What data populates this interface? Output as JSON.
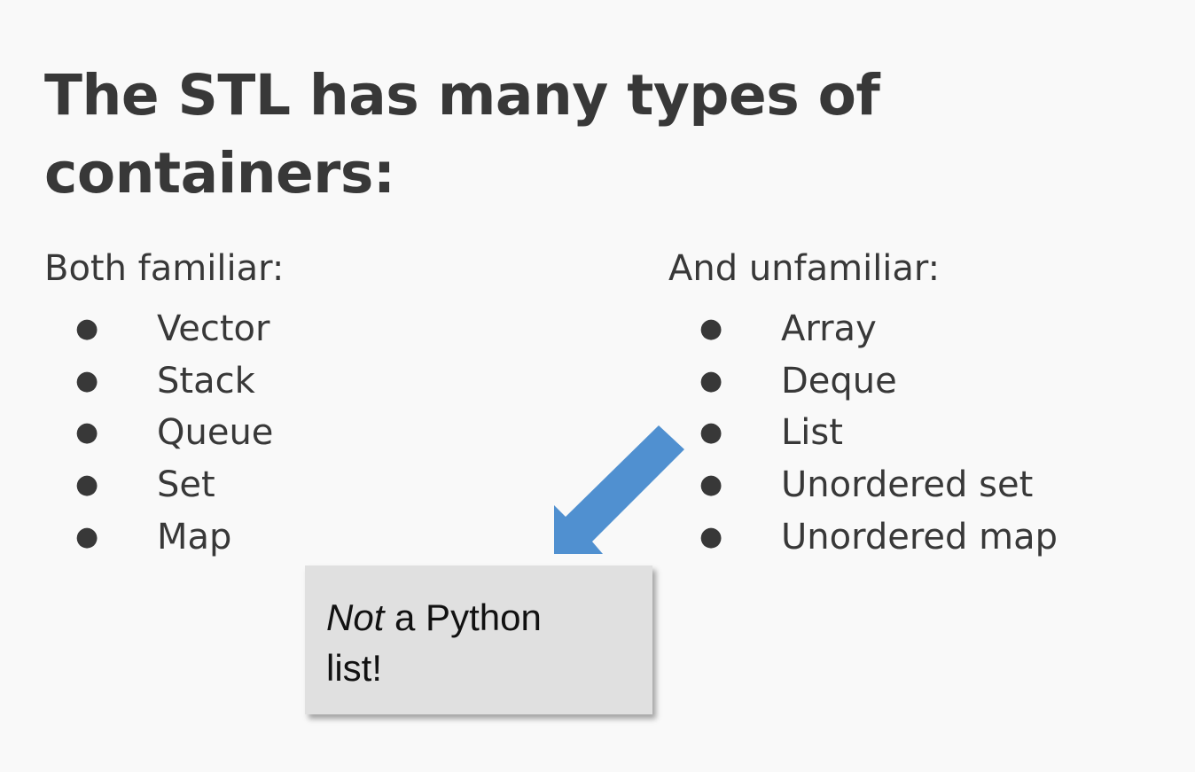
{
  "slide": {
    "title": "The STL has many types of containers:"
  },
  "left_column": {
    "heading": "Both familiar:",
    "items": [
      "Vector",
      "Stack",
      "Queue",
      "Set",
      "Map"
    ]
  },
  "right_column": {
    "heading": "And unfamiliar:",
    "items": [
      "Array",
      "Deque",
      "List",
      "Unordered set",
      "Unordered map"
    ]
  },
  "callout": {
    "emphasis": "Not",
    "rest_line1": " a Python",
    "line2": "list!"
  },
  "bullet_glyph": "●",
  "colors": {
    "background": "#f9f9f9",
    "text": "#383838",
    "arrow": "#5090d0",
    "callout_bg": "#e0e0e0"
  },
  "icons": {
    "arrow": "arrow-down-left-icon"
  }
}
